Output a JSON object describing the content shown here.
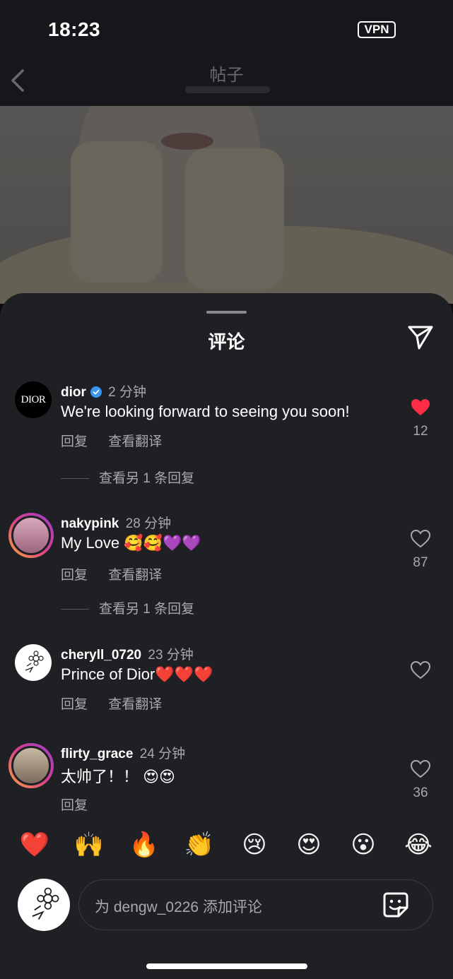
{
  "status_bar": {
    "time": "18:23",
    "vpn": "VPN"
  },
  "header": {
    "title": "帖子",
    "back_icon": "chevron-left-icon"
  },
  "sheet": {
    "title": "评论",
    "share_icon": "paper-plane-icon"
  },
  "comments": [
    {
      "user": "dior",
      "verified": true,
      "time": "2 分钟",
      "text": "We're looking forward to seeing you soon!",
      "actions": [
        "回复",
        "查看翻译"
      ],
      "view_replies": "查看另 1 条回复",
      "liked": true,
      "likes": "12",
      "avatar_label": "DIOR"
    },
    {
      "user": "nakypink",
      "verified": false,
      "time": "28 分钟",
      "text": "My Love 🥰🥰💜💜",
      "actions": [
        "回复",
        "查看翻译"
      ],
      "view_replies": "查看另 1 条回复",
      "liked": false,
      "likes": "87"
    },
    {
      "user": "cheryll_0720",
      "verified": false,
      "time": "23 分钟",
      "text": "Prince of Dior❤️❤️❤️",
      "actions": [
        "回复",
        "查看翻译"
      ],
      "liked": false,
      "likes": ""
    },
    {
      "user": "flirty_grace",
      "verified": false,
      "time": "24 分钟",
      "text": "太帅了！！ 😍😍",
      "actions": [
        "回复"
      ],
      "liked": false,
      "likes": "36"
    }
  ],
  "quick_reactions": [
    "❤️",
    "🙌",
    "🔥",
    "👏",
    "😢",
    "😍",
    "😮",
    "😂"
  ],
  "composer": {
    "placeholder": "为 dengw_0226 添加评论",
    "sticker_icon": "sticker-icon"
  },
  "colors": {
    "like_red": "#ff2d46",
    "verified_blue": "#3897f0",
    "sheet_bg": "#1f2024"
  }
}
